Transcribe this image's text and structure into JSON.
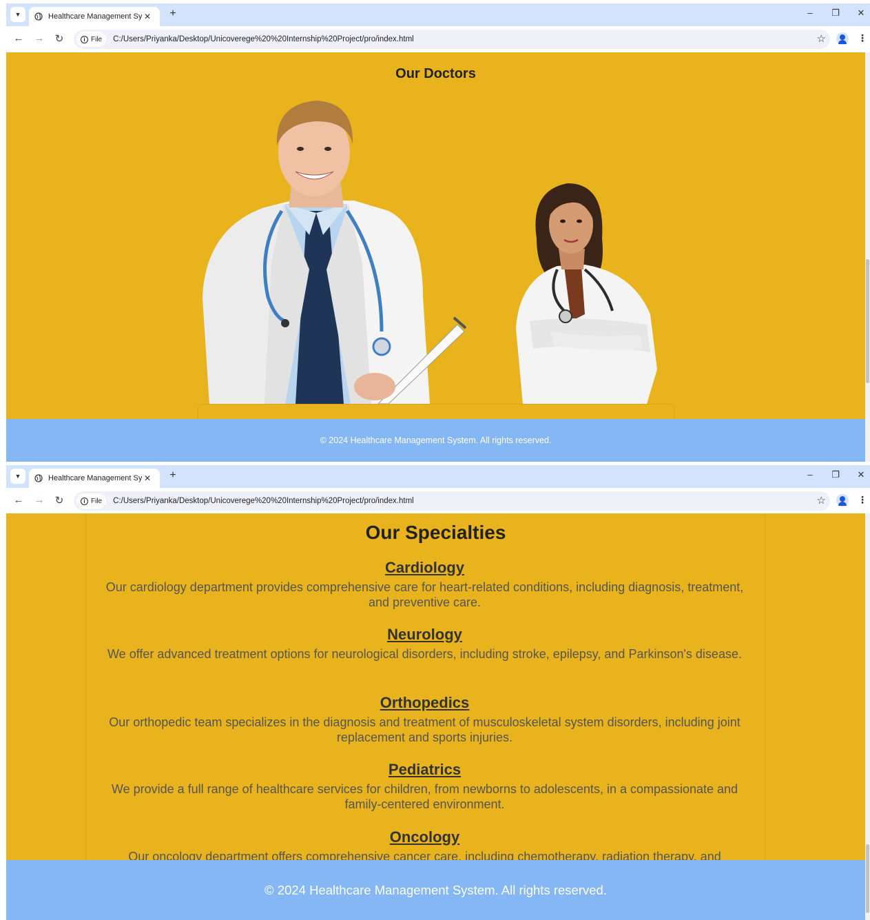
{
  "browser": {
    "tab_title": "Healthcare Management System",
    "url_chip": "File",
    "url": "C:/Users/Priyanka/Desktop/Unicoverege%20%20Internship%20Project/pro/index.html"
  },
  "doctors_section": {
    "title": "Our Doctors"
  },
  "specialties_section": {
    "title": "Our Specialties",
    "items": [
      {
        "name": "Cardiology",
        "description": "Our cardiology department provides comprehensive care for heart-related conditions, including diagnosis, treatment, and preventive care."
      },
      {
        "name": "Neurology",
        "description": "We offer advanced treatment options for neurological disorders, including stroke, epilepsy, and Parkinson's disease."
      },
      {
        "name": "Orthopedics",
        "description": "Our orthopedic team specializes in the diagnosis and treatment of musculoskeletal system disorders, including joint replacement and sports injuries."
      },
      {
        "name": "Pediatrics",
        "description": "We provide a full range of healthcare services for children, from newborns to adolescents, in a compassionate and family-centered environment."
      },
      {
        "name": "Oncology",
        "description": "Our oncology department offers comprehensive cancer care, including chemotherapy, radiation therapy, and"
      }
    ]
  },
  "footer": {
    "text": "© 2024 Healthcare Management System. All rights reserved."
  },
  "colors": {
    "page_background": "#e8b31c",
    "footer_background": "#84b7f4",
    "tab_strip": "#d3e3fd"
  }
}
